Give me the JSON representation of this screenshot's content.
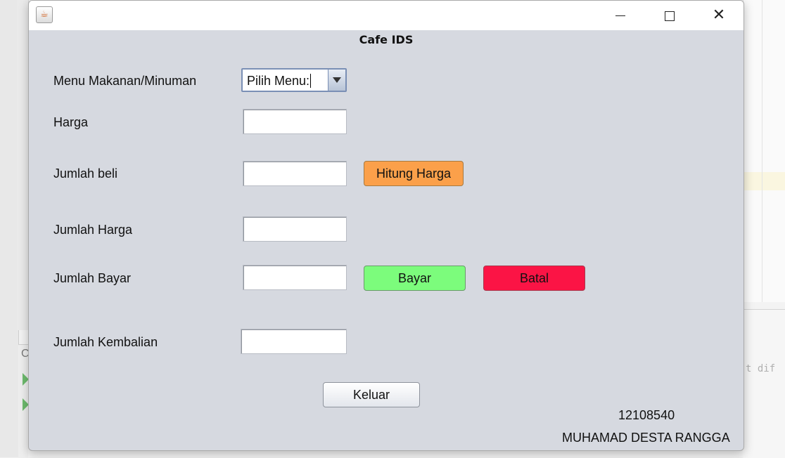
{
  "background": {
    "right_text": "t dif",
    "left_glyph": "C"
  },
  "window": {
    "title_icon": "java-cup-icon"
  },
  "form": {
    "title": "Cafe IDS",
    "labels": {
      "menu": "Menu Makanan/Minuman",
      "harga": "Harga",
      "jumlah_beli": "Jumlah beli",
      "jumlah_harga": "Jumlah Harga",
      "jumlah_bayar": "Jumlah Bayar",
      "jumlah_kembalian": "Jumlah Kembalian"
    },
    "menu_select": {
      "selected": "Pilih Menu:"
    },
    "fields": {
      "harga": "",
      "jumlah_beli": "",
      "jumlah_harga": "",
      "jumlah_bayar": "",
      "jumlah_kembalian": ""
    },
    "buttons": {
      "hitung": "Hitung Harga",
      "bayar": "Bayar",
      "batal": "Batal",
      "keluar": "Keluar"
    },
    "colors": {
      "hitung": "#fba04a",
      "bayar": "#7cfc7c",
      "batal": "#fb1445",
      "window_bg": "#d6d9e0"
    },
    "footer": {
      "nim": "12108540",
      "name": "MUHAMAD DESTA RANGGA"
    }
  }
}
